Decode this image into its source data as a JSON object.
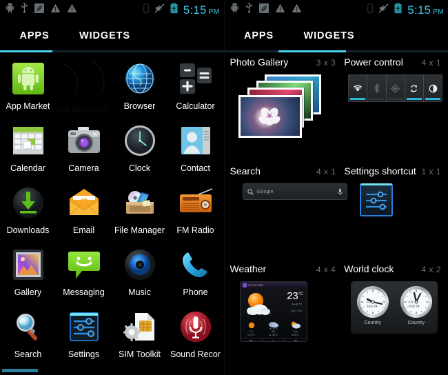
{
  "status_bar": {
    "icons_left": [
      "android-debug-icon",
      "usb-icon",
      "leaf-icon",
      "warning-triangle-icon",
      "warning-triangle-icon"
    ],
    "icons_right": [
      "sim-icon",
      "mute-icon",
      "battery-charging-icon"
    ],
    "time": "5:15",
    "ampm": "PM",
    "clock_color": "#3bc6e8"
  },
  "left_panel": {
    "tabs": [
      {
        "label": "APPS",
        "active": true
      },
      {
        "label": "WIDGETS",
        "active": false
      }
    ],
    "accent_color": "#4cd5ef",
    "apps": [
      {
        "label": "App Market",
        "icon": "app-market-icon"
      },
      {
        "label": "Browser",
        "icon": "browser-icon"
      },
      {
        "label": "Calculator",
        "icon": "calculator-icon"
      },
      {
        "label": "",
        "icon": "empty-slot"
      },
      {
        "label": "Calendar",
        "icon": "calendar-icon"
      },
      {
        "label": "Camera",
        "icon": "camera-icon"
      },
      {
        "label": "Clock",
        "icon": "clock-icon"
      },
      {
        "label": "Contact",
        "icon": "contact-icon"
      },
      {
        "label": "Downloads",
        "icon": "downloads-icon"
      },
      {
        "label": "Email",
        "icon": "email-icon"
      },
      {
        "label": "File Manager",
        "icon": "file-manager-icon"
      },
      {
        "label": "FM Radio",
        "icon": "fm-radio-icon"
      },
      {
        "label": "Gallery",
        "icon": "gallery-icon"
      },
      {
        "label": "Messaging",
        "icon": "messaging-icon"
      },
      {
        "label": "Music",
        "icon": "music-icon"
      },
      {
        "label": "Phone",
        "icon": "phone-icon"
      },
      {
        "label": "Search",
        "icon": "search-icon"
      },
      {
        "label": "Settings",
        "icon": "settings-icon"
      },
      {
        "label": "SIM Toolkit",
        "icon": "sim-toolkit-icon"
      },
      {
        "label": "Sound Recor",
        "icon": "sound-recorder-icon"
      }
    ]
  },
  "right_panel": {
    "tabs": [
      {
        "label": "APPS",
        "active": false
      },
      {
        "label": "WIDGETS",
        "active": true
      }
    ],
    "accent_color": "#4cd5ef",
    "widgets": [
      {
        "title": "Photo Gallery",
        "size": "3 x 3",
        "preview": "photo-stack-preview"
      },
      {
        "title": "Power control",
        "size": "4 x 1",
        "preview": "power-control-preview"
      },
      {
        "title": "Search",
        "size": "4 x 1",
        "preview": "search-bar-preview"
      },
      {
        "title": "Settings shortcut",
        "size": "1 x 1",
        "preview": "settings-shortcut-preview"
      },
      {
        "title": "Weather",
        "size": "4 x 4",
        "preview": "weather-preview"
      },
      {
        "title": "World clock",
        "size": "4 x 2",
        "preview": "world-clock-preview"
      }
    ],
    "power_control": {
      "toggles": [
        {
          "name": "wifi",
          "on": true
        },
        {
          "name": "bluetooth",
          "on": false
        },
        {
          "name": "gps",
          "on": false
        },
        {
          "name": "sync",
          "on": true
        },
        {
          "name": "brightness",
          "on": true
        }
      ]
    },
    "search_widget": {
      "hint": "Google"
    },
    "weather_widget": {
      "header": "WEATHER",
      "temperature": "23",
      "unit": "°C",
      "range": "9~31°C",
      "city": "City / N/S",
      "forecast": [
        {
          "day": "Fri",
          "temp": "9-23°C"
        },
        {
          "day": "Sat",
          "temp": "11-30°C"
        },
        {
          "day": "Sun",
          "temp": "8-25°C"
        }
      ]
    },
    "world_clock": {
      "clocks": [
        {
          "day": "Fri",
          "date": "Feb 24",
          "label": "Country"
        },
        {
          "day": "Fri",
          "date": "Feb 24",
          "label": "Country"
        }
      ]
    }
  }
}
